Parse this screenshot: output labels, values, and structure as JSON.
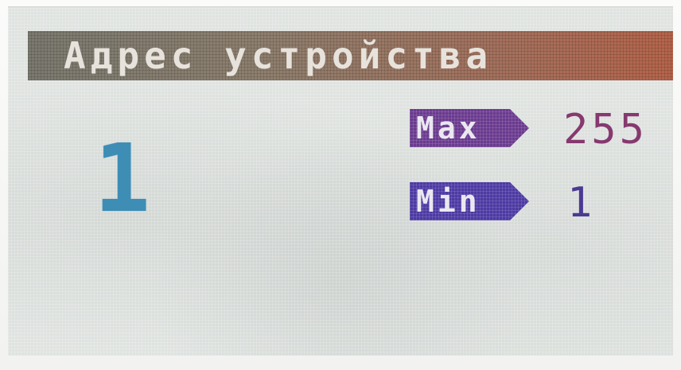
{
  "screen": {
    "title": "Адрес устройства",
    "current_value": "1",
    "max": {
      "label": "Max",
      "value": "255"
    },
    "min": {
      "label": "Min",
      "value": "1"
    }
  },
  "colors": {
    "title_bar_start": "#7b7a70",
    "title_bar_end": "#b5644b",
    "current_value": "#3d8db5",
    "max_tag": "#6a3a8f",
    "min_tag": "#4d3aa3",
    "max_value": "#86396f",
    "min_value": "#4b3a93"
  }
}
